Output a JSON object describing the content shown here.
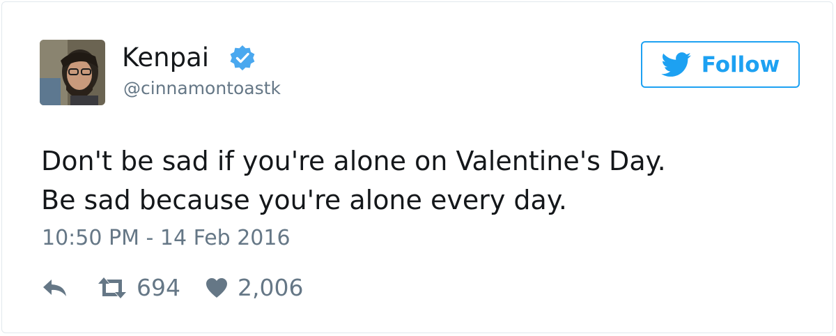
{
  "user": {
    "display_name": "Kenpai",
    "handle": "@cinnamontoastk",
    "avatar_icon": "user-avatar-photo",
    "verified_icon": "verified-badge-icon"
  },
  "follow_button": {
    "label": "Follow",
    "icon": "twitter-bird-icon"
  },
  "tweet": {
    "lines": [
      "Don't be sad if you're alone on Valentine's Day.",
      "Be sad because you're alone every day."
    ],
    "timestamp": "10:50 PM - 14 Feb 2016"
  },
  "actions": {
    "reply_icon": "reply-icon",
    "retweet_icon": "retweet-icon",
    "retweet_count": "694",
    "like_icon": "heart-icon",
    "like_count": "2,006"
  },
  "colors": {
    "accent": "#1da1f2",
    "verified": "#4aa8ef",
    "text": "#14171a",
    "muted": "#657786",
    "border": "#e1e8ed"
  }
}
